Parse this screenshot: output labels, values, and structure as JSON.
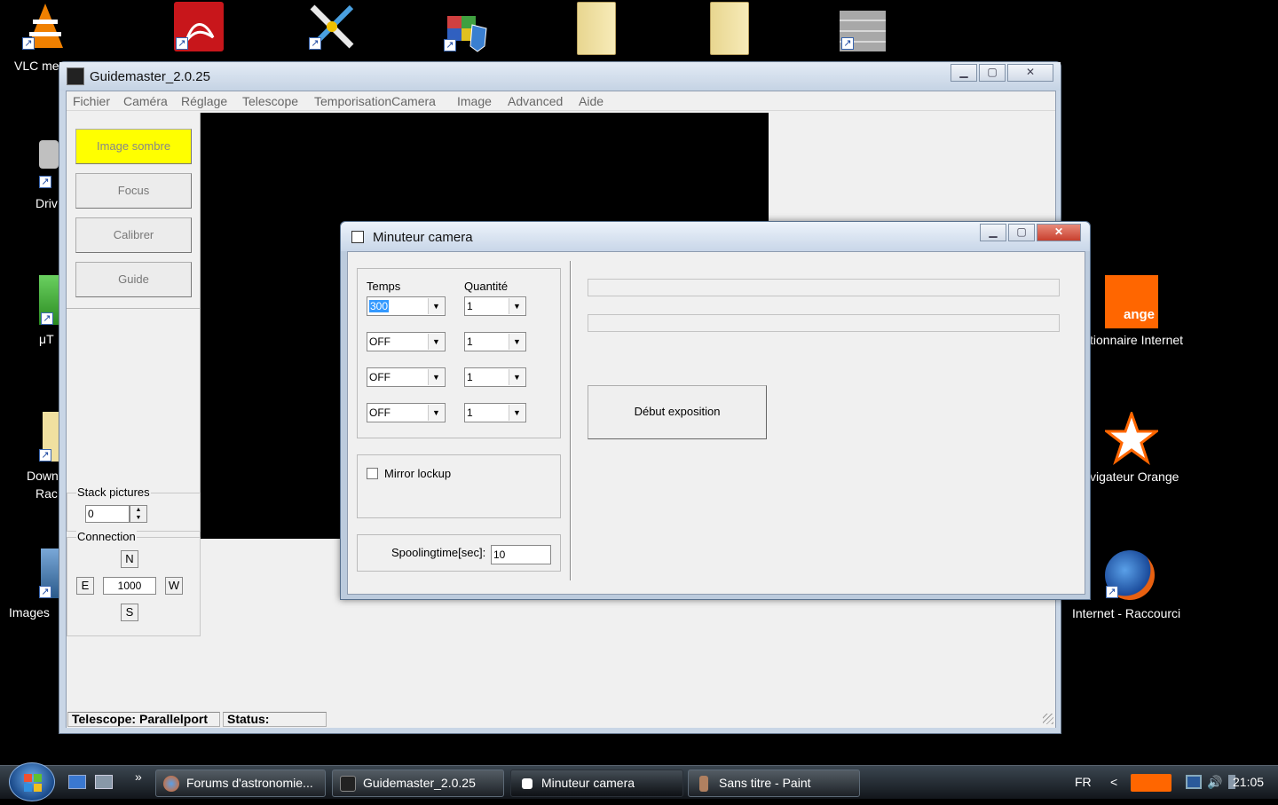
{
  "desktop": {
    "icons": [
      {
        "label": "VLC me",
        "icon": "vlc-cone-icon"
      },
      {
        "label": "Driv",
        "icon": "driver-tool-icon"
      },
      {
        "label": "μT",
        "icon": "utorrent-icon"
      },
      {
        "label": "Down",
        "sublabel": "Rac",
        "icon": "folder-icon"
      },
      {
        "label": "Images",
        "icon": "images-icon"
      },
      {
        "label": "tionnaire Internet",
        "icon": "orange-logo-icon"
      },
      {
        "label": "vigateur Orange",
        "icon": "orange-star-icon"
      },
      {
        "label": "Internet - Raccourci",
        "icon": "firefox-icon"
      }
    ],
    "orange_logo_text": "ange"
  },
  "main_window": {
    "title": "Guidemaster_2.0.25",
    "menu": [
      "Fichier",
      "Caméra",
      "Réglage",
      "Telescope",
      "TemporisationCamera",
      "Image",
      "Advanced",
      "Aide"
    ],
    "buttons": {
      "dark": "Image sombre",
      "focus": "Focus",
      "calibrate": "Calibrer",
      "guide": "Guide"
    },
    "stack": {
      "label": "Stack pictures",
      "value": "0"
    },
    "connection": {
      "label": "Connection",
      "n": "N",
      "e": "E",
      "w": "W",
      "s": "S",
      "value": "1000"
    },
    "status": {
      "telescope": "Telescope: Parallelport",
      "status": "Status:"
    }
  },
  "dialog": {
    "title": "Minuteur camera",
    "col_time": "Temps",
    "col_qty": "Quantité",
    "rows": [
      {
        "time": "300",
        "qty": "1"
      },
      {
        "time": "OFF",
        "qty": "1"
      },
      {
        "time": "OFF",
        "qty": "1"
      },
      {
        "time": "OFF",
        "qty": "1"
      }
    ],
    "mirror_lockup": "Mirror lockup",
    "spooling_label": "Spoolingtime[sec]:",
    "spooling_value": "10",
    "start_button": "Début exposition"
  },
  "taskbar": {
    "tasks": [
      "Forums d'astronomie...",
      "Guidemaster_2.0.25",
      "Minuteur camera",
      "Sans titre - Paint"
    ],
    "chevron": "»",
    "language": "FR",
    "time": "21:05"
  },
  "colors": {
    "yellow_button": "#ffff00",
    "selection": "#3399ff",
    "close_red": "#c8402e"
  }
}
